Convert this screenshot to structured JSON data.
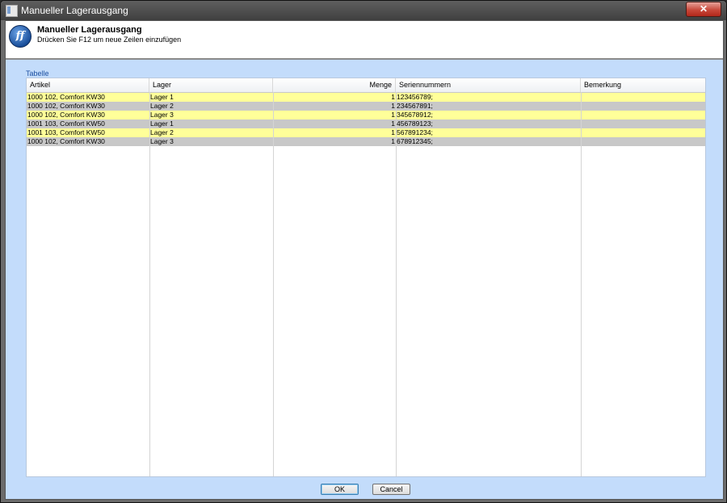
{
  "window": {
    "title": "Manueller Lagerausgang",
    "close_label": "✕"
  },
  "header": {
    "logo_text": "ff",
    "title": "Manueller Lagerausgang",
    "subtitle": "Drücken Sie F12 um neue Zeilen einzufügen"
  },
  "section": {
    "label": "Tabelle"
  },
  "table": {
    "columns": [
      "Artikel",
      "Lager",
      "Menge",
      "Seriennummern",
      "Bemerkung"
    ],
    "rows": [
      {
        "artikel": "1000 102, Comfort KW30",
        "lager": "Lager 1",
        "menge": "1",
        "seriennummern": "123456789;",
        "bemerkung": "",
        "style": "yellow"
      },
      {
        "artikel": "1000 102, Comfort KW30",
        "lager": "Lager 2",
        "menge": "1",
        "seriennummern": "234567891;",
        "bemerkung": "",
        "style": "gray"
      },
      {
        "artikel": "1000 102, Comfort KW30",
        "lager": "Lager 3",
        "menge": "1",
        "seriennummern": "345678912;",
        "bemerkung": "",
        "style": "yellow"
      },
      {
        "artikel": "1001 103, Comfort KW50",
        "lager": "Lager 1",
        "menge": "1",
        "seriennummern": "456789123;",
        "bemerkung": "",
        "style": "gray"
      },
      {
        "artikel": "1001 103, Comfort KW50",
        "lager": "Lager 2",
        "menge": "1",
        "seriennummern": "567891234;",
        "bemerkung": "",
        "style": "yellow"
      },
      {
        "artikel": "1000 102, Comfort KW30",
        "lager": "Lager 3",
        "menge": "1",
        "seriennummern": "678912345;",
        "bemerkung": "",
        "style": "gray"
      }
    ]
  },
  "buttons": {
    "ok": "OK",
    "cancel": "Cancel"
  },
  "colors": {
    "row_yellow": "#ffff99",
    "row_gray": "#c8c8c8",
    "body_background": "#c3dcfb",
    "accent": "#1c4fa0"
  }
}
